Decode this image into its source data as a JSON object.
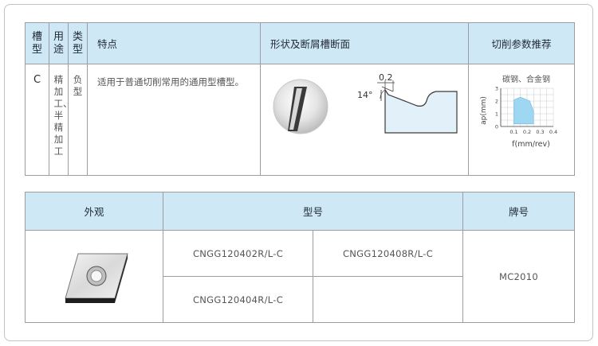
{
  "table1": {
    "headers": {
      "groove": "槽型",
      "use": "用途",
      "type": "类型",
      "features": "特点",
      "shape": "形状及断屑槽断面",
      "params": "切削参数推荐"
    },
    "row": {
      "groove": "C",
      "use": "精加工、半精加工",
      "type": "负型",
      "features": "适用于普通切削常用的通用型槽型。",
      "angle_label": "14°",
      "land_label": "0.2",
      "chart_title": "碳钢、合金钢"
    }
  },
  "chart_data": {
    "type": "area",
    "title": "碳钢、合金钢",
    "xlabel": "f(mm/rev)",
    "ylabel": "ap(mm)",
    "xlim": [
      0,
      0.4
    ],
    "ylim": [
      0,
      3
    ],
    "xticks": [
      "0.1",
      "0.2",
      "0.3",
      "0.4"
    ],
    "yticks": [
      "0",
      "1",
      "2",
      "3"
    ],
    "polygon": [
      [
        0.1,
        0.2
      ],
      [
        0.1,
        2.1
      ],
      [
        0.15,
        2.3
      ],
      [
        0.22,
        2.0
      ],
      [
        0.25,
        1.2
      ],
      [
        0.25,
        0.2
      ]
    ],
    "grid": true,
    "fill_color": "#9fd6f2"
  },
  "table2": {
    "headers": {
      "appearance": "外观",
      "model": "型号",
      "grade": "牌号"
    },
    "models": [
      "CNGG120402R/L-C",
      "CNGG120408R/L-C",
      "CNGG120404R/L-C",
      ""
    ],
    "grade": "MC2010"
  },
  "colors": {
    "header_bg": "#cfe8f5",
    "border": "#9a9ea2",
    "accent": "#a9d3ea"
  }
}
